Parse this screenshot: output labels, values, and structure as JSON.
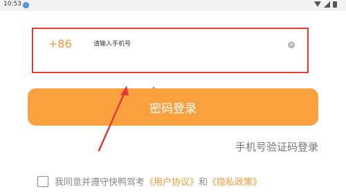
{
  "status_bar": {
    "time": "10:53",
    "info_glyph": "i"
  },
  "phone_row": {
    "country_code": "+86",
    "placeholder": "请输入手机号",
    "clear_glyph": "×"
  },
  "primary_button": {
    "label": "密码登录",
    "color": "#f9a03f"
  },
  "secondary_link": {
    "label": "手机号验证码登录"
  },
  "agreement": {
    "text": "我同意并遵守快鸭驾考",
    "user_agreement": "《用户协议》",
    "conjunction": "和",
    "privacy_policy": "《隐私政策》"
  },
  "colors": {
    "accent": "#f19a3b",
    "highlight": "#e53935"
  }
}
